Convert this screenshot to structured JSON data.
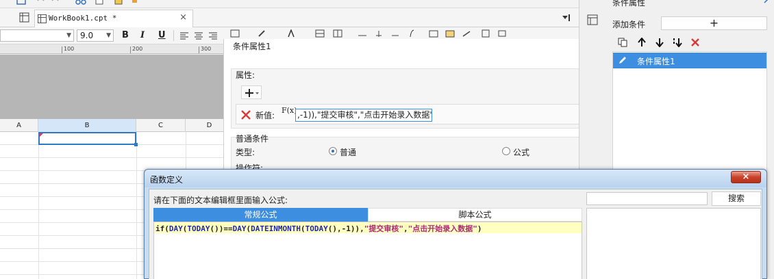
{
  "document_tab": {
    "label": "WorkBook1.cpt *",
    "close": "×"
  },
  "format_bar": {
    "font_value": "",
    "font_size": "9.0",
    "bold": "B",
    "italic": "I",
    "underline": "U"
  },
  "ruler": {
    "marks": [
      "100",
      "200",
      "300"
    ]
  },
  "grid": {
    "columns": [
      "A",
      "B",
      "C",
      "D"
    ]
  },
  "condition_panel": {
    "title": "条件属性1",
    "attributes_label": "属性:",
    "new_value_label": "新值:",
    "fx_label": "F(x)",
    "new_value": ",-1)),\"提交审核\",\"点击开始录入数据\")",
    "normal_condition_label": "普通条件",
    "type_label": "类型:",
    "type_normal": "普通",
    "type_formula": "公式",
    "operator_label": "操作符:",
    "hidden_row_label": "操作"
  },
  "sidebar": {
    "header": "条件属性",
    "add_condition_label": "添加条件",
    "add_button": "+",
    "items": [
      {
        "label": "条件属性1"
      }
    ]
  },
  "dialog": {
    "title": "函数定义",
    "close": "×",
    "prompt": "请在下面的文本编辑框里面输入公式:",
    "tabs": [
      "常规公式",
      "脚本公式"
    ],
    "search_placeholder": "",
    "search_button": "搜索",
    "formula": {
      "p1": "if(",
      "k1": "DAY",
      "p2": "(",
      "k2": "TODAY",
      "p3": "())==",
      "k3": "DAY",
      "p4": "(",
      "k4": "DATEINMONTH",
      "p5": "(",
      "k5": "TODAY",
      "p6": "(),-1)),",
      "s1": "\"提交审核\"",
      "p7": ",",
      "s2": "\"点击开始录入数据\"",
      "p8": ")"
    }
  },
  "colors": {
    "accent": "#3d8ee0",
    "selection_border": "#2f78c8",
    "delete_red": "#d83a3a",
    "formula_keyword": "#1f2aa8",
    "formula_string": "#b0287a",
    "editor_line": "#ffffc0"
  }
}
